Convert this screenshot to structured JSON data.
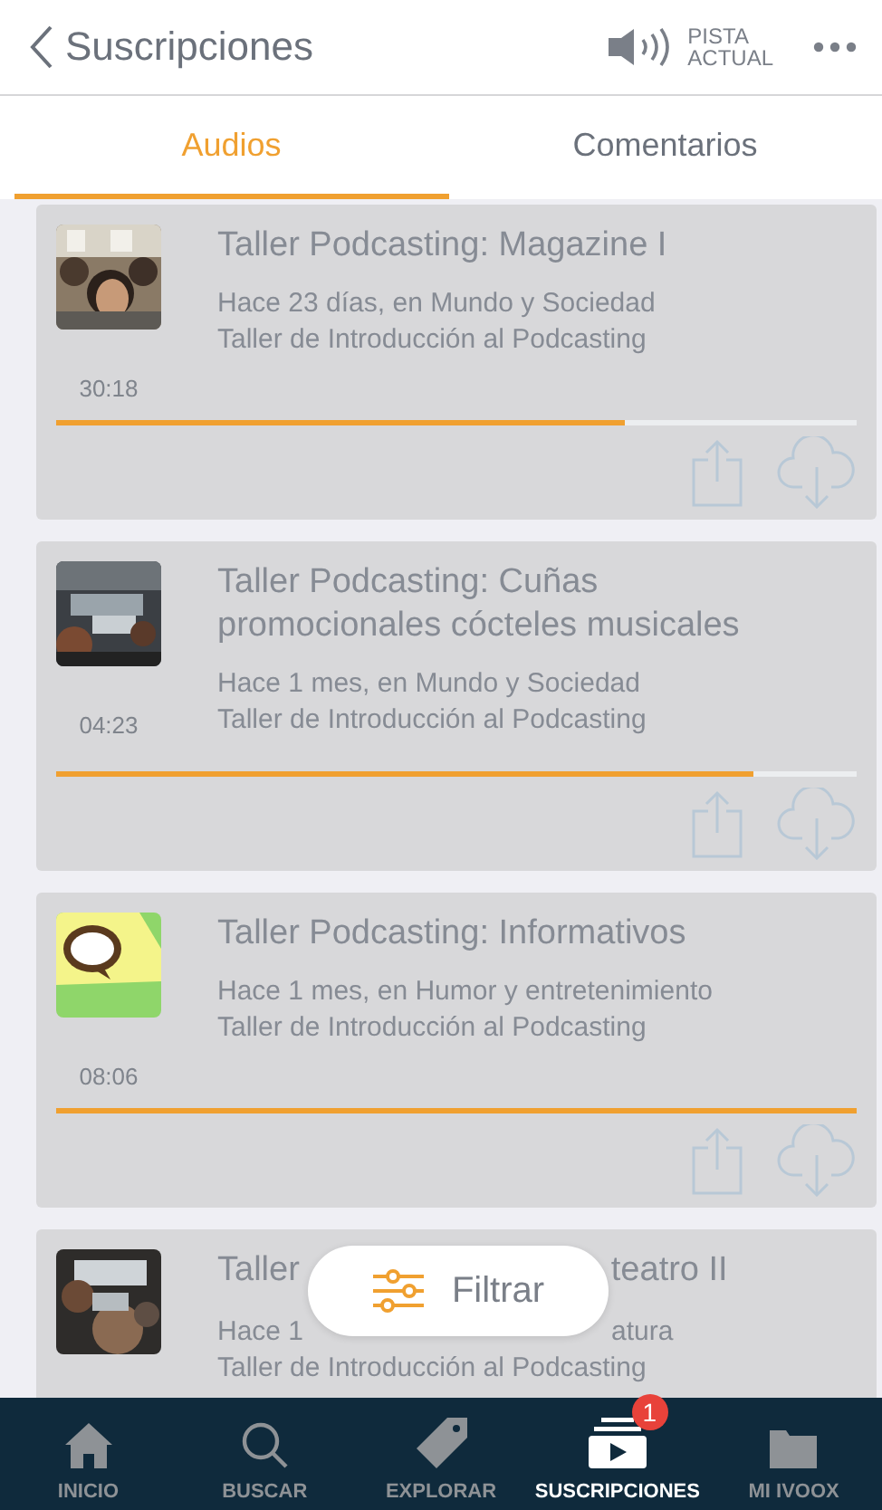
{
  "header": {
    "back_label": "Suscripciones",
    "now_playing": [
      "PISTA",
      "ACTUAL"
    ]
  },
  "tabs": [
    {
      "label": "Audios",
      "selected": true
    },
    {
      "label": "Comentarios",
      "selected": false
    }
  ],
  "episodes": [
    {
      "kind": "full",
      "title": "Taller Podcasting: Magazine I",
      "meta": "Hace 23 días, en Mundo y Sociedad",
      "program": "Taller de Introducción al Podcasting",
      "duration": "30:18",
      "level": 0.71
    },
    {
      "kind": "full",
      "title": "Taller Podcasting: Cuñas promocionales cócteles musicales",
      "meta": "Hace 1 mes, en Mundo y Sociedad",
      "program": "Taller de Introducción al Podcasting",
      "duration": "04:23",
      "level": 0.87
    },
    {
      "kind": "full",
      "title": "Taller Podcasting: Informativos",
      "meta": "Hace 1 mes, en Humor y entretenimiento",
      "program": "Taller de Introducción al Podcasting",
      "duration": "08:06",
      "level": 1
    },
    {
      "kind": "covered",
      "title_parts": [
        "Taller",
        "teatro II"
      ],
      "meta_parts": [
        "Hace 1",
        "atura"
      ],
      "program": "Taller de Introducción al Podcasting"
    }
  ],
  "filter_button": {
    "label": "Filtrar"
  },
  "nav": [
    {
      "label": "INICIO",
      "selected": false
    },
    {
      "label": "BUSCAR",
      "selected": false
    },
    {
      "label": "EXPLORAR",
      "selected": false
    },
    {
      "label": "SUSCRIPCIONES",
      "selected": true,
      "badge": "1"
    },
    {
      "label": "MI IVOOX",
      "selected": false
    }
  ]
}
